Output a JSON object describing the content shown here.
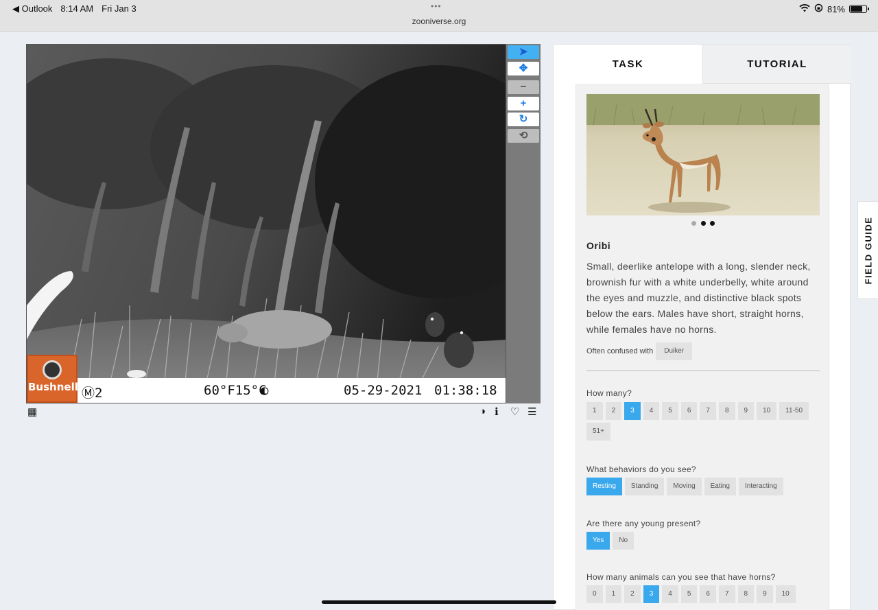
{
  "status_bar": {
    "back_app": "◀ Outlook",
    "time": "8:14 AM",
    "date": "Fri Jan 3",
    "dots": "•••",
    "url": "zooniverse.org",
    "battery": "81%",
    "battery_level": 0.81,
    "icons": [
      "wifi-icon",
      "orientation-lock-icon",
      "battery-icon"
    ]
  },
  "viewer": {
    "camera_brand": "Bushnell",
    "camera_id": "Ⓜ2",
    "temperature": "60°F15°C",
    "moon_phase": "◐",
    "date": "05-29-2021",
    "time": "01:38:18"
  },
  "toolbar": {
    "tools": [
      {
        "name": "annotate-tool",
        "glyph": "➤"
      },
      {
        "name": "pan-tool",
        "glyph": "✥"
      },
      {
        "name": "zoom-out-tool",
        "glyph": "−"
      },
      {
        "name": "zoom-in-tool",
        "glyph": "+"
      },
      {
        "name": "rotate-tool",
        "glyph": "↻"
      },
      {
        "name": "reset-tool",
        "glyph": "⟲"
      }
    ]
  },
  "below_viewer": {
    "grid_icon": "▦",
    "invert_icon": "◑",
    "info_icon": "ℹ",
    "favorite_icon": "♡",
    "collections_icon": "☰"
  },
  "tabs": {
    "task": "TASK",
    "tutorial": "TUTORIAL"
  },
  "field_guide_tab": "FIELD GUIDE",
  "species": {
    "name": "Oribi",
    "description": "Small, deerlike antelope with a long, slender neck, brownish fur with a white underbelly, white around the eyes and muzzle, and distinctive black spots below the ears. Males have short, straight horns, while females have no horns.",
    "confused_label": "Often confused with",
    "confused_with": "Duiker",
    "image_dots": 3,
    "active_dot": 2
  },
  "questions": [
    {
      "label": "How many?",
      "options": [
        "1",
        "2",
        "3",
        "4",
        "5",
        "6",
        "7",
        "8",
        "9",
        "10",
        "11-50",
        "51+"
      ],
      "selected": [
        "3"
      ]
    },
    {
      "label": "What behaviors do you see?",
      "options": [
        "Resting",
        "Standing",
        "Moving",
        "Eating",
        "Interacting"
      ],
      "selected": [
        "Resting"
      ]
    },
    {
      "label": "Are there any young present?",
      "options": [
        "Yes",
        "No"
      ],
      "selected": [
        "Yes"
      ]
    },
    {
      "label": "How many animals can you see that have horns?",
      "options": [
        "0",
        "1",
        "2",
        "3",
        "4",
        "5",
        "6",
        "7",
        "8",
        "9",
        "10"
      ],
      "selected": [
        "3"
      ]
    }
  ],
  "colors": {
    "accent": "#3aa8ec",
    "tool_blue": "#1a7be0",
    "bushnell_orange": "#d9652a"
  }
}
